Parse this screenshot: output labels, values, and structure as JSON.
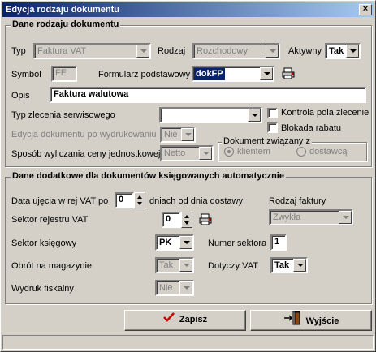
{
  "window": {
    "title": "Edycja rodzaju dokumentu",
    "close_label": "×"
  },
  "main_group": {
    "title": "Dane rodzaju dokumentu",
    "typ_label": "Typ",
    "typ_value": "Faktura VAT",
    "rodzaj_label": "Rodzaj",
    "rodzaj_value": "Rozchodowy",
    "aktywny_label": "Aktywny",
    "aktywny_value": "Tak",
    "symbol_label": "Symbol",
    "symbol_value": "FE",
    "formularz_label": "Formularz podstawowy",
    "formularz_value": "dokFP",
    "opis_label": "Opis",
    "opis_value": "Faktura walutowa",
    "typ_zlecenia_label": "Typ zlecenia serwisowego",
    "typ_zlecenia_value": "",
    "kontrola_label": "Kontrola pola zlecenie",
    "blokada_label": "Blokada rabatu",
    "edycja_label": "Edycja dokumentu po wydrukowaniu",
    "edycja_value": "Nie",
    "sposob_label": "Sposób wyliczania ceny jednostkowej",
    "sposob_value": "Netto",
    "dokument_zwiazany_label": "Dokument związany z",
    "radio_klientem": "klientem",
    "radio_dostawca": "dostawcą"
  },
  "auto_group": {
    "title": "Dane dodatkowe dla dokumentów księgowanych automatycznie",
    "data_ujecia_label": "Data ujęcia w rej VAT po",
    "data_ujecia_value": "0",
    "dniach_label": "dniach od dnia dostawy",
    "rodzaj_faktury_label": "Rodzaj faktury",
    "rodzaj_faktury_value": "Zwykła",
    "sektor_vat_label": "Sektor rejestru VAT",
    "sektor_vat_value": "0",
    "sektor_ksiegowy_label": "Sektor księgowy",
    "sektor_ksiegowy_value": "PK",
    "numer_sektora_label": "Numer sektora",
    "numer_sektora_value": "1",
    "obrot_label": "Obrót na magazynie",
    "obrot_value": "Tak",
    "dotyczy_vat_label": "Dotyczy VAT",
    "dotyczy_vat_value": "Tak",
    "wydruk_label": "Wydruk fiskalny",
    "wydruk_value": "Nie"
  },
  "buttons": {
    "save": "Zapisz",
    "exit": "Wyjście"
  },
  "colors": {
    "title_start": "#0a246a",
    "title_end": "#a6caf0",
    "face": "#d4d0c8",
    "save_icon": "#cc0000"
  }
}
